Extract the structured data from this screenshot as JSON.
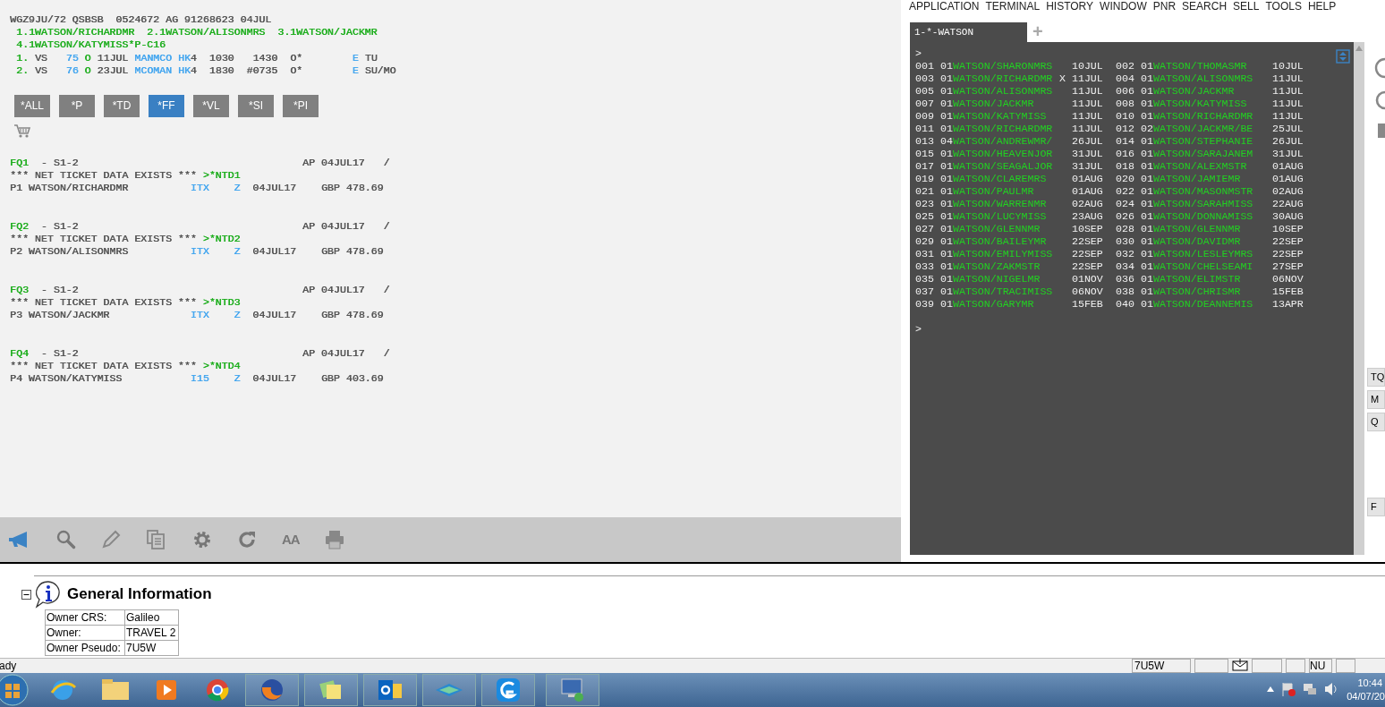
{
  "header_title": {
    "segments": [
      {
        "text": "WGZ9JU/72 QSBSB  0524672 AG 91268623 04JUL",
        "color": "#555555"
      }
    ]
  },
  "header_lines": [
    {
      "segments": [
        {
          "text": "1.1WATSON/RICHARDMR  2.1WATSON/ALISONMRS  3.1WATSON/JACKMR",
          "color": "#1fae1f"
        }
      ]
    },
    {
      "segments": [
        {
          "text": "4.1WATSON/KATYMISS*P-C16",
          "color": "#1fae1f"
        }
      ]
    },
    {
      "segments": [
        {
          "text": "1.",
          "color": "#1fae1f"
        },
        {
          "text": " VS   ",
          "color": "#555555"
        },
        {
          "text": "75",
          "color": "#44a6ef"
        },
        {
          "text": " O",
          "color": "#1fae1f"
        },
        {
          "text": " 11JUL ",
          "color": "#555555"
        },
        {
          "text": "MANMCO HK",
          "color": "#44a6ef"
        },
        {
          "text": "4  1030   1430  O*        ",
          "color": "#555555"
        },
        {
          "text": "E",
          "color": "#44a6ef"
        },
        {
          "text": " TU",
          "color": "#555555"
        }
      ]
    },
    {
      "segments": [
        {
          "text": "2.",
          "color": "#1fae1f"
        },
        {
          "text": " VS   ",
          "color": "#555555"
        },
        {
          "text": "76",
          "color": "#44a6ef"
        },
        {
          "text": " O",
          "color": "#1fae1f"
        },
        {
          "text": " 23JUL ",
          "color": "#555555"
        },
        {
          "text": "MCOMAN HK",
          "color": "#44a6ef"
        },
        {
          "text": "4  1830  #0735  O*        ",
          "color": "#555555"
        },
        {
          "text": "E",
          "color": "#44a6ef"
        },
        {
          "text": " SU/MO",
          "color": "#555555"
        }
      ]
    }
  ],
  "filter_buttons": [
    {
      "label": "*ALL",
      "selected": false
    },
    {
      "label": "*P",
      "selected": false
    },
    {
      "label": "*TD",
      "selected": false
    },
    {
      "label": "*FF",
      "selected": true
    },
    {
      "label": "*VL",
      "selected": false
    },
    {
      "label": "*SI",
      "selected": false
    },
    {
      "label": "*PI",
      "selected": false
    }
  ],
  "fare_blocks": [
    [
      {
        "segments": [
          {
            "text": "FQ1",
            "color": "#1fae1f"
          },
          {
            "text": "  - S1-2                                    AP 04JUL17   /",
            "color": "#555555"
          }
        ]
      },
      {
        "segments": [
          {
            "text": "*** NET TICKET DATA EXISTS *** ",
            "color": "#555555"
          },
          {
            "text": ">*NTD1",
            "color": "#1fae1f"
          }
        ]
      },
      {
        "segments": [
          {
            "text": "P1 WATSON/RICHARDMR          ",
            "color": "#555555"
          },
          {
            "text": "ITX    Z",
            "color": "#44a6ef"
          },
          {
            "text": "  04JUL17    GBP 478.69",
            "color": "#555555"
          }
        ]
      }
    ],
    [
      {
        "segments": [
          {
            "text": "FQ2",
            "color": "#1fae1f"
          },
          {
            "text": "  - S1-2                                    AP 04JUL17   /",
            "color": "#555555"
          }
        ]
      },
      {
        "segments": [
          {
            "text": "*** NET TICKET DATA EXISTS *** ",
            "color": "#555555"
          },
          {
            "text": ">*NTD2",
            "color": "#1fae1f"
          }
        ]
      },
      {
        "segments": [
          {
            "text": "P2 WATSON/ALISONMRS          ",
            "color": "#555555"
          },
          {
            "text": "ITX    Z",
            "color": "#44a6ef"
          },
          {
            "text": "  04JUL17    GBP 478.69",
            "color": "#555555"
          }
        ]
      }
    ],
    [
      {
        "segments": [
          {
            "text": "FQ3",
            "color": "#1fae1f"
          },
          {
            "text": "  - S1-2                                    AP 04JUL17   /",
            "color": "#555555"
          }
        ]
      },
      {
        "segments": [
          {
            "text": "*** NET TICKET DATA EXISTS *** ",
            "color": "#555555"
          },
          {
            "text": ">*NTD3",
            "color": "#1fae1f"
          }
        ]
      },
      {
        "segments": [
          {
            "text": "P3 WATSON/JACKMR             ",
            "color": "#555555"
          },
          {
            "text": "ITX    Z",
            "color": "#44a6ef"
          },
          {
            "text": "  04JUL17    GBP 478.69",
            "color": "#555555"
          }
        ]
      }
    ],
    [
      {
        "segments": [
          {
            "text": "FQ4",
            "color": "#1fae1f"
          },
          {
            "text": "  - S1-2                                    AP 04JUL17   /",
            "color": "#555555"
          }
        ]
      },
      {
        "segments": [
          {
            "text": "*** NET TICKET DATA EXISTS *** ",
            "color": "#555555"
          },
          {
            "text": ">*NTD4",
            "color": "#1fae1f"
          }
        ]
      },
      {
        "segments": [
          {
            "text": "P4 WATSON/KATYMISS           ",
            "color": "#555555"
          },
          {
            "text": "I15    Z",
            "color": "#44a6ef"
          },
          {
            "text": "  04JUL17    GBP 403.69",
            "color": "#555555"
          }
        ]
      }
    ]
  ],
  "toolbar": {
    "font_size_label": "AA"
  },
  "menu": [
    "APPLICATION",
    "TERMINAL",
    "HISTORY",
    "WINDOW",
    "PNR",
    "SEARCH",
    "SELL",
    "TOOLS",
    "HELP"
  ],
  "terminal_tab": {
    "label": "1-*-WATSON",
    "add_label": "+"
  },
  "terminal": {
    "prompt_top": ">",
    "prompt_bottom": ">",
    "entries": [
      {
        "num": "001",
        "count": "01",
        "name": "WATSON/SHARONMRS",
        "date": "10JUL"
      },
      {
        "num": "002",
        "count": "01",
        "name": "WATSON/THOMASMR",
        "date": "10JUL"
      },
      {
        "num": "003",
        "count": "01",
        "name": "WATSON/RICHARDMR",
        "marker": "X",
        "date": "11JUL"
      },
      {
        "num": "004",
        "count": "01",
        "name": "WATSON/ALISONMRS",
        "date": "11JUL"
      },
      {
        "num": "005",
        "count": "01",
        "name": "WATSON/ALISONMRS",
        "date": "11JUL"
      },
      {
        "num": "006",
        "count": "01",
        "name": "WATSON/JACKMR",
        "date": "11JUL"
      },
      {
        "num": "007",
        "count": "01",
        "name": "WATSON/JACKMR",
        "date": "11JUL"
      },
      {
        "num": "008",
        "count": "01",
        "name": "WATSON/KATYMISS",
        "date": "11JUL"
      },
      {
        "num": "009",
        "count": "01",
        "name": "WATSON/KATYMISS",
        "date": "11JUL"
      },
      {
        "num": "010",
        "count": "01",
        "name": "WATSON/RICHARDMR",
        "date": "11JUL"
      },
      {
        "num": "011",
        "count": "01",
        "name": "WATSON/RICHARDMR",
        "date": "11JUL"
      },
      {
        "num": "012",
        "count": "02",
        "name": "WATSON/JACKMR/BE",
        "date": "25JUL"
      },
      {
        "num": "013",
        "count": "04",
        "name": "WATSON/ANDREWMR/",
        "date": "26JUL"
      },
      {
        "num": "014",
        "count": "01",
        "name": "WATSON/STEPHANIE",
        "date": "26JUL"
      },
      {
        "num": "015",
        "count": "01",
        "name": "WATSON/HEAVENJOR",
        "date": "31JUL"
      },
      {
        "num": "016",
        "count": "01",
        "name": "WATSON/SARAJANEM",
        "date": "31JUL"
      },
      {
        "num": "017",
        "count": "01",
        "name": "WATSON/SEAGALJOR",
        "date": "31JUL"
      },
      {
        "num": "018",
        "count": "01",
        "name": "WATSON/ALEXMSTR",
        "date": "01AUG"
      },
      {
        "num": "019",
        "count": "01",
        "name": "WATSON/CLAREMRS",
        "date": "01AUG"
      },
      {
        "num": "020",
        "count": "01",
        "name": "WATSON/JAMIEMR",
        "date": "01AUG"
      },
      {
        "num": "021",
        "count": "01",
        "name": "WATSON/PAULMR",
        "date": "01AUG"
      },
      {
        "num": "022",
        "count": "01",
        "name": "WATSON/MASONMSTR",
        "date": "02AUG"
      },
      {
        "num": "023",
        "count": "01",
        "name": "WATSON/WARRENMR",
        "date": "02AUG"
      },
      {
        "num": "024",
        "count": "01",
        "name": "WATSON/SARAHMISS",
        "date": "22AUG"
      },
      {
        "num": "025",
        "count": "01",
        "name": "WATSON/LUCYMISS",
        "date": "23AUG"
      },
      {
        "num": "026",
        "count": "01",
        "name": "WATSON/DONNAMISS",
        "date": "30AUG"
      },
      {
        "num": "027",
        "count": "01",
        "name": "WATSON/GLENNMR",
        "date": "10SEP"
      },
      {
        "num": "028",
        "count": "01",
        "name": "WATSON/GLENNMR",
        "date": "10SEP"
      },
      {
        "num": "029",
        "count": "01",
        "name": "WATSON/BAILEYMR",
        "date": "22SEP"
      },
      {
        "num": "030",
        "count": "01",
        "name": "WATSON/DAVIDMR",
        "date": "22SEP"
      },
      {
        "num": "031",
        "count": "01",
        "name": "WATSON/EMILYMISS",
        "date": "22SEP"
      },
      {
        "num": "032",
        "count": "01",
        "name": "WATSON/LESLEYMRS",
        "date": "22SEP"
      },
      {
        "num": "033",
        "count": "01",
        "name": "WATSON/ZAKMSTR",
        "date": "22SEP"
      },
      {
        "num": "034",
        "count": "01",
        "name": "WATSON/CHELSEAMI",
        "date": "27SEP"
      },
      {
        "num": "035",
        "count": "01",
        "name": "WATSON/NIGELMR",
        "date": "01NOV"
      },
      {
        "num": "036",
        "count": "01",
        "name": "WATSON/ELIMSTR",
        "date": "06NOV"
      },
      {
        "num": "037",
        "count": "01",
        "name": "WATSON/TRACIMISS",
        "date": "06NOV"
      },
      {
        "num": "038",
        "count": "01",
        "name": "WATSON/CHRISMR",
        "date": "15FEB"
      },
      {
        "num": "039",
        "count": "01",
        "name": "WATSON/GARYMR",
        "date": "15FEB"
      },
      {
        "num": "040",
        "count": "01",
        "name": "WATSON/DEANNEMIS",
        "date": "13APR"
      }
    ]
  },
  "side_buttons": [
    "TQ",
    "M",
    "Q",
    "F"
  ],
  "general_info": {
    "title": "General Information",
    "rows": [
      {
        "label": "Owner CRS:",
        "value": "Galileo"
      },
      {
        "label": "Owner:",
        "value": "TRAVEL 2"
      },
      {
        "label": "Owner Pseudo:",
        "value": "7U5W"
      }
    ]
  },
  "status_bar": {
    "text": "ady",
    "pseudo": "7U5W",
    "num_lock": "NU"
  },
  "taskbar": {
    "time": "10:44",
    "date": "04/07/20"
  }
}
